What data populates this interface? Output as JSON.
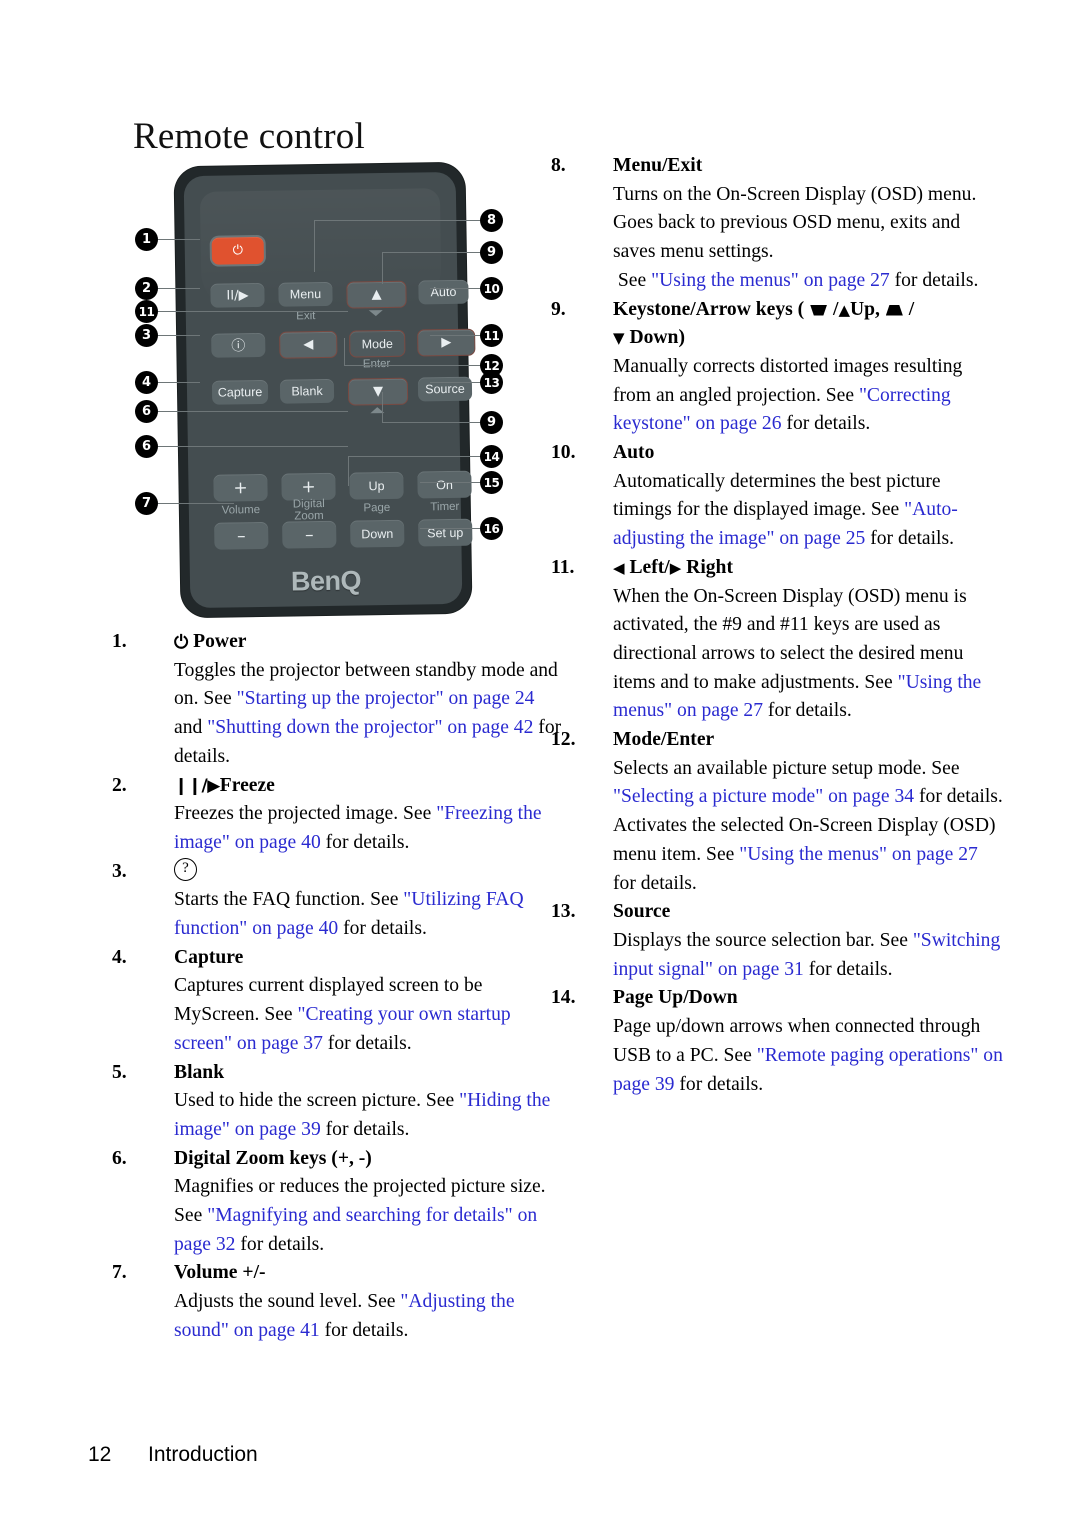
{
  "title": "Remote control",
  "footer": {
    "page_number": "12",
    "section": "Introduction"
  },
  "figure": {
    "brand": "BenQ",
    "buttons": {
      "power": "⏻",
      "freeze": "II/▶",
      "menu": "Menu",
      "menu_sub": "Exit",
      "up": "▲",
      "auto": "Auto",
      "faq": "?",
      "left": "◀",
      "mode": "Mode",
      "mode_sub": "Enter",
      "right": "▶",
      "capture": "Capture",
      "blank": "Blank",
      "down": "▼",
      "source": "Source",
      "volume_plus": "+",
      "volume_minus": "–",
      "volume_label": "Volume",
      "zoom_plus": "+",
      "zoom_minus": "–",
      "zoom_label_1": "Digital",
      "zoom_label_2": "Zoom",
      "page_up": "Up",
      "page_down": "Down",
      "page_label": "Page",
      "timer_on": "On",
      "timer_setup": "Set up",
      "timer_label": "Timer"
    },
    "callouts_left": [
      "1",
      "2",
      "11",
      "3",
      "4",
      "6",
      "6",
      "7"
    ],
    "callouts_right": [
      "8",
      "9",
      "10",
      "11",
      "12",
      "13",
      "9",
      "14",
      "15",
      "16"
    ]
  },
  "left_column": [
    {
      "num": "1.",
      "term_prefix_icon": "power-glyph",
      "term": "Power",
      "desc": [
        {
          "t": "Toggles the projector between standby mode and on. See ",
          "link": false
        },
        {
          "t": "\"Starting up the projector\" on page 24",
          "link": true
        },
        {
          "t": " and ",
          "link": false
        },
        {
          "t": "\"Shutting down the projector\" on page 42",
          "link": true
        },
        {
          "t": " for details.",
          "link": false
        }
      ]
    },
    {
      "num": "2.",
      "term_prefix_icon": "freeze-glyph",
      "term": "Freeze",
      "desc": [
        {
          "t": "Freezes the projected image. See ",
          "link": false
        },
        {
          "t": "\"Freezing the image\" on page 40",
          "link": true
        },
        {
          "t": " for details.",
          "link": false
        }
      ]
    },
    {
      "num": "3.",
      "term_prefix_icon": "faq-circle-icon",
      "term": "",
      "desc": [
        {
          "t": "Starts the FAQ function. See ",
          "link": false
        },
        {
          "t": "\"Utilizing FAQ function\" on page 40",
          "link": true
        },
        {
          "t": " for details.",
          "link": false
        }
      ]
    },
    {
      "num": "4.",
      "term": "Capture",
      "desc": [
        {
          "t": "Captures current displayed screen to be MyScreen. See ",
          "link": false
        },
        {
          "t": "\"Creating your own startup screen\" on page 37",
          "link": true
        },
        {
          "t": " for details.",
          "link": false
        }
      ]
    },
    {
      "num": "5.",
      "term": "Blank",
      "desc": [
        {
          "t": "Used to hide the screen picture. See ",
          "link": false
        },
        {
          "t": "\"Hiding the image\" on page 39",
          "link": true
        },
        {
          "t": " for details.",
          "link": false
        }
      ]
    },
    {
      "num": "6.",
      "term": "Digital Zoom keys (+, -)",
      "desc": [
        {
          "t": "Magnifies or reduces the projected picture size. See ",
          "link": false
        },
        {
          "t": "\"Magnifying and searching for details\" on page 32",
          "link": true
        },
        {
          "t": " for details.",
          "link": false
        }
      ]
    },
    {
      "num": "7.",
      "term": "Volume +/-",
      "desc": [
        {
          "t": "Adjusts the sound level. See ",
          "link": false
        },
        {
          "t": "\"Adjusting the sound\" on page 41",
          "link": true
        },
        {
          "t": " for details.",
          "link": false
        }
      ]
    }
  ],
  "right_column": [
    {
      "num": "8.",
      "term": "Menu/Exit",
      "desc": [
        {
          "t": "Turns on the On-Screen Display (OSD) menu. Goes back to previous OSD menu, exits and saves menu settings.",
          "link": false
        },
        {
          "t": " ",
          "link": false,
          "br": true
        },
        {
          "t": "See ",
          "link": false
        },
        {
          "t": "\"Using the menus\" on page 27",
          "link": true
        },
        {
          "t": " for details.",
          "link": false
        }
      ]
    },
    {
      "num": "9.",
      "term_html": "keystone",
      "term": "Keystone/Arrow keys ( / Up,  / Down)",
      "desc": [
        {
          "t": "Manually corrects distorted images resulting from an angled projection. See ",
          "link": false
        },
        {
          "t": "\"Correcting keystone\" on page 26",
          "link": true
        },
        {
          "t": " for details.",
          "link": false
        }
      ]
    },
    {
      "num": "10.",
      "term": "Auto",
      "desc": [
        {
          "t": "Automatically determines the best picture timings for the displayed image. See ",
          "link": false
        },
        {
          "t": "\"Auto-adjusting the image\" on page 25",
          "link": true
        },
        {
          "t": " for details.",
          "link": false
        }
      ]
    },
    {
      "num": "11.",
      "term_html": "leftright",
      "term": "◀ Left/▶ Right",
      "desc": [
        {
          "t": "When the On-Screen Display (OSD) menu is activated, the #9 and #11 keys are used as directional arrows to select the desired menu items and to make adjustments. See ",
          "link": false
        },
        {
          "t": "\"Using the menus\" on page 27",
          "link": true
        },
        {
          "t": " for details.",
          "link": false
        }
      ]
    },
    {
      "num": "12.",
      "term": "Mode/Enter",
      "desc": [
        {
          "t": "Selects an available picture setup mode. See ",
          "link": false
        },
        {
          "t": "\"Selecting a picture mode\" on page 34",
          "link": true
        },
        {
          "t": " for details.",
          "link": false
        },
        {
          "t": "Activates the selected On-Screen Display (OSD) menu item. See ",
          "link": false,
          "br": true
        },
        {
          "t": "\"Using the menus\" on page 27",
          "link": true
        },
        {
          "t": " for details.",
          "link": false
        }
      ]
    },
    {
      "num": "13.",
      "term": "Source",
      "desc": [
        {
          "t": "Displays the source selection bar. See ",
          "link": false
        },
        {
          "t": "\"Switching input signal\" on page 31",
          "link": true
        },
        {
          "t": " for details.",
          "link": false
        }
      ]
    },
    {
      "num": "14.",
      "term": "Page Up/Down",
      "desc": [
        {
          "t": "Page up/down arrows when connected through USB to a PC. See ",
          "link": false
        },
        {
          "t": "\"Remote paging operations\" on page 39",
          "link": true
        },
        {
          "t": " for details.",
          "link": false
        }
      ]
    }
  ]
}
